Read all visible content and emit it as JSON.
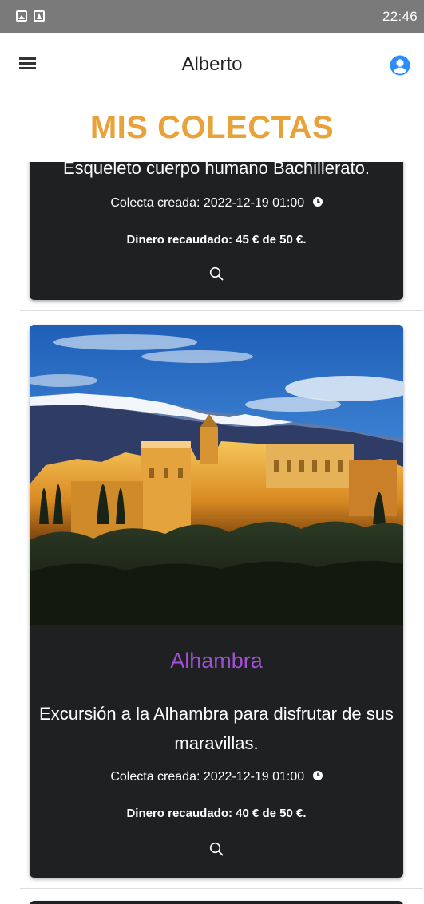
{
  "status_bar": {
    "time": "22:46",
    "icons": [
      "gallery-icon",
      "app-icon"
    ]
  },
  "header": {
    "title": "Alberto",
    "menu_icon": "hamburger-menu-icon",
    "user_icon": "account-circle-icon"
  },
  "page": {
    "title": "MIS COLECTAS"
  },
  "colors": {
    "accent_title": "#e8a23a",
    "card_title": "#a24fd6",
    "card_background": "#1f2022",
    "user_icon": "#2a8ff7"
  },
  "collections": [
    {
      "title": "",
      "description": "Esqueleto cuerpo humano Bachillerato.",
      "created": "Colecta creada: 2022-12-19 01:00",
      "raised": "Dinero recaudado: 45 € de 50 €.",
      "icon": "search-icon"
    },
    {
      "title": "Alhambra",
      "description": "Excursión a la Alhambra para disfrutar de sus maravillas.",
      "created": "Colecta creada: 2022-12-19 01:00",
      "raised": "Dinero recaudado: 40 € de 50 €.",
      "icon": "search-icon"
    }
  ]
}
